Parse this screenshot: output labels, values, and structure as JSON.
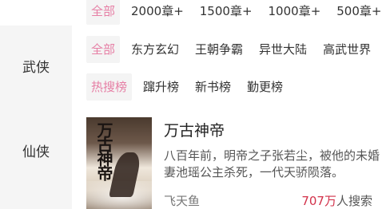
{
  "sidebar": {
    "categories": [
      {
        "label": "武侠"
      },
      {
        "label": "仙侠"
      }
    ]
  },
  "filters": {
    "word_count": [
      "全部",
      "2000章+",
      "1500章+",
      "1000章+",
      "500章+"
    ],
    "world_type": [
      "全部",
      "东方玄幻",
      "王朝争霸",
      "异世大陆",
      "高武世界"
    ],
    "rank_type": [
      "热搜榜",
      "蹿升榜",
      "新书榜",
      "勤更榜"
    ]
  },
  "book": {
    "title": "万古神帝",
    "cover_text": "万古神帝",
    "intro": "八百年前，明帝之子张若尘，被他的未婚妻池瑶公主杀死，一代天骄陨落。",
    "author": "飞天鱼",
    "search_count": "707万",
    "search_suffix": "人搜索"
  },
  "colors": {
    "accent": "#e67fa5",
    "count_red": "#d2314a",
    "sidebar_bg": "#f5f5f5"
  }
}
